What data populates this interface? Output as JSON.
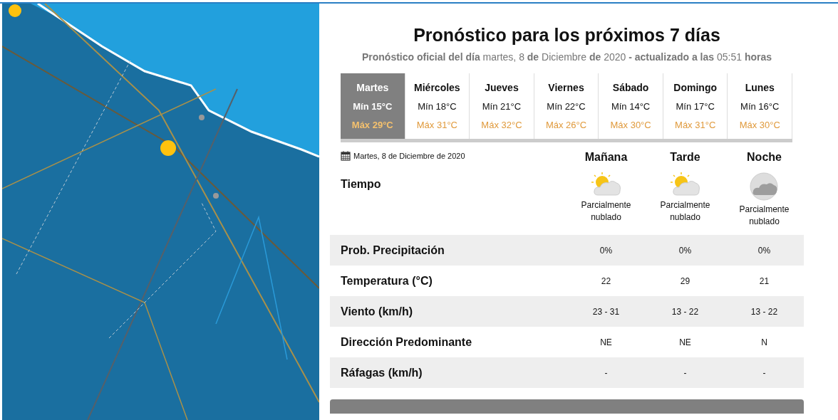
{
  "forecast": {
    "title": "Pronóstico para los próximos 7 días",
    "subtitle": "**Pronóstico oficial del día** martes, 8 **de** Diciembre **de** 2020 **- actualizado a las** 05:51 **horas**",
    "days": [
      {
        "name": "Martes",
        "min": "Mín 15°C",
        "max": "Máx 29°C",
        "selected": true
      },
      {
        "name": "Miércoles",
        "min": "Mín 18°C",
        "max": "Máx 31°C",
        "selected": false
      },
      {
        "name": "Jueves",
        "min": "Mín 21°C",
        "max": "Máx 32°C",
        "selected": false
      },
      {
        "name": "Viernes",
        "min": "Mín 22°C",
        "max": "Máx 26°C",
        "selected": false
      },
      {
        "name": "Sábado",
        "min": "Mín 14°C",
        "max": "Máx 30°C",
        "selected": false
      },
      {
        "name": "Domingo",
        "min": "Mín 17°C",
        "max": "Máx 31°C",
        "selected": false
      },
      {
        "name": "Lunes",
        "min": "Mín 16°C",
        "max": "Máx 30°C",
        "selected": false
      }
    ],
    "date": "Martes, 8 de Diciembre de 2020",
    "weather_label": "Tiempo",
    "periods": [
      {
        "name": "Mañana",
        "kind": "sun-cloud",
        "sky": "Parcialmente nublado"
      },
      {
        "name": "Tarde",
        "kind": "sun-cloud",
        "sky": "Parcialmente nublado"
      },
      {
        "name": "Noche",
        "kind": "moon-cloud",
        "sky": "Parcialmente nublado"
      }
    ],
    "rows": [
      {
        "label": "Prob. Precipitación",
        "values": [
          "0%",
          "0%",
          "0%"
        ]
      },
      {
        "label": "Temperatura (°C)",
        "values": [
          "22",
          "29",
          "21"
        ]
      },
      {
        "label": "Viento (km/h)",
        "values": [
          "23 - 31",
          "13 - 22",
          "13 - 22"
        ]
      },
      {
        "label": "Dirección Predominante",
        "values": [
          "NE",
          "NE",
          "N"
        ]
      },
      {
        "label": "Ráfagas (km/h)",
        "values": [
          "-",
          "-",
          "-"
        ]
      }
    ]
  }
}
